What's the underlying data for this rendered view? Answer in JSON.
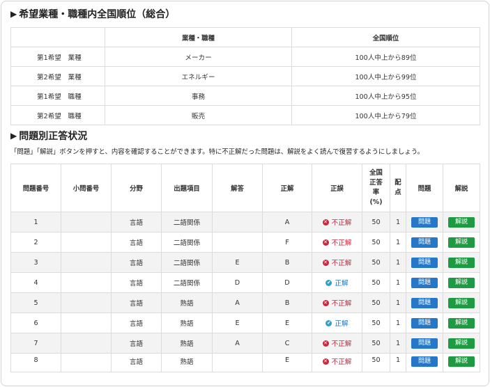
{
  "section1": {
    "title": "希望業種・職種内全国順位（総合）",
    "headers": [
      "",
      "業種・職種",
      "全国順位"
    ],
    "rows": [
      {
        "label": "第1希望　業種",
        "field": "メーカー",
        "rank": "100人中上から89位"
      },
      {
        "label": "第2希望　業種",
        "field": "エネルギー",
        "rank": "100人中上から99位"
      },
      {
        "label": "第1希望　職種",
        "field": "事務",
        "rank": "100人中上から95位"
      },
      {
        "label": "第2希望　職種",
        "field": "販売",
        "rank": "100人中上から79位"
      }
    ]
  },
  "section2": {
    "title": "問題別正答状況",
    "note": "「問題」「解説」ボタンを押すと、内容を確認することができます。特に不正解だった問題は、解説をよく読んで復習するようにしましょう。",
    "headers": {
      "no": "問題番号",
      "sub": "小問番号",
      "field": "分野",
      "item": "出題項目",
      "answer": "解答",
      "correct": "正解",
      "judge": "正誤",
      "rate": [
        "全国",
        "正答",
        "率",
        "(%)"
      ],
      "points": [
        "配",
        "点"
      ],
      "problem": "問題",
      "explain": "解説"
    },
    "rows": [
      {
        "no": "1",
        "sub": "",
        "field": "言語",
        "item": "二語関係",
        "answer": "",
        "correct": "A",
        "judge": "不正解",
        "ok": false,
        "rate": "50",
        "points": "1",
        "problem": "問題",
        "explain": "解説"
      },
      {
        "no": "2",
        "sub": "",
        "field": "言語",
        "item": "二語関係",
        "answer": "",
        "correct": "F",
        "judge": "不正解",
        "ok": false,
        "rate": "50",
        "points": "1",
        "problem": "問題",
        "explain": "解説"
      },
      {
        "no": "3",
        "sub": "",
        "field": "言語",
        "item": "二語関係",
        "answer": "E",
        "correct": "B",
        "judge": "不正解",
        "ok": false,
        "rate": "50",
        "points": "1",
        "problem": "問題",
        "explain": "解説"
      },
      {
        "no": "4",
        "sub": "",
        "field": "言語",
        "item": "二語関係",
        "answer": "D",
        "correct": "D",
        "judge": "正解",
        "ok": true,
        "rate": "50",
        "points": "1",
        "problem": "問題",
        "explain": "解説"
      },
      {
        "no": "5",
        "sub": "",
        "field": "言語",
        "item": "熟語",
        "answer": "A",
        "correct": "B",
        "judge": "不正解",
        "ok": false,
        "rate": "50",
        "points": "1",
        "problem": "問題",
        "explain": "解説"
      },
      {
        "no": "6",
        "sub": "",
        "field": "言語",
        "item": "熟語",
        "answer": "E",
        "correct": "E",
        "judge": "正解",
        "ok": true,
        "rate": "50",
        "points": "1",
        "problem": "問題",
        "explain": "解説"
      },
      {
        "no": "7",
        "sub": "",
        "field": "言語",
        "item": "熟語",
        "answer": "A",
        "correct": "C",
        "judge": "不正解",
        "ok": false,
        "rate": "50",
        "points": "1",
        "problem": "問題",
        "explain": "解説"
      },
      {
        "no": "8",
        "sub": "",
        "field": "言語",
        "item": "熟語",
        "answer": "",
        "correct": "E",
        "judge": "不正解",
        "ok": false,
        "rate": "50",
        "points": "1",
        "problem": "問題",
        "explain": "解説"
      }
    ]
  },
  "icons": {
    "triangle": "play-triangle-icon",
    "incorrect": "x-circle-icon",
    "correct": "check-circle-icon"
  },
  "colors": {
    "button_problem": "#2677c8",
    "button_explain": "#1e9a43",
    "incorrect": "#c8273c",
    "correct": "#2677c8"
  }
}
